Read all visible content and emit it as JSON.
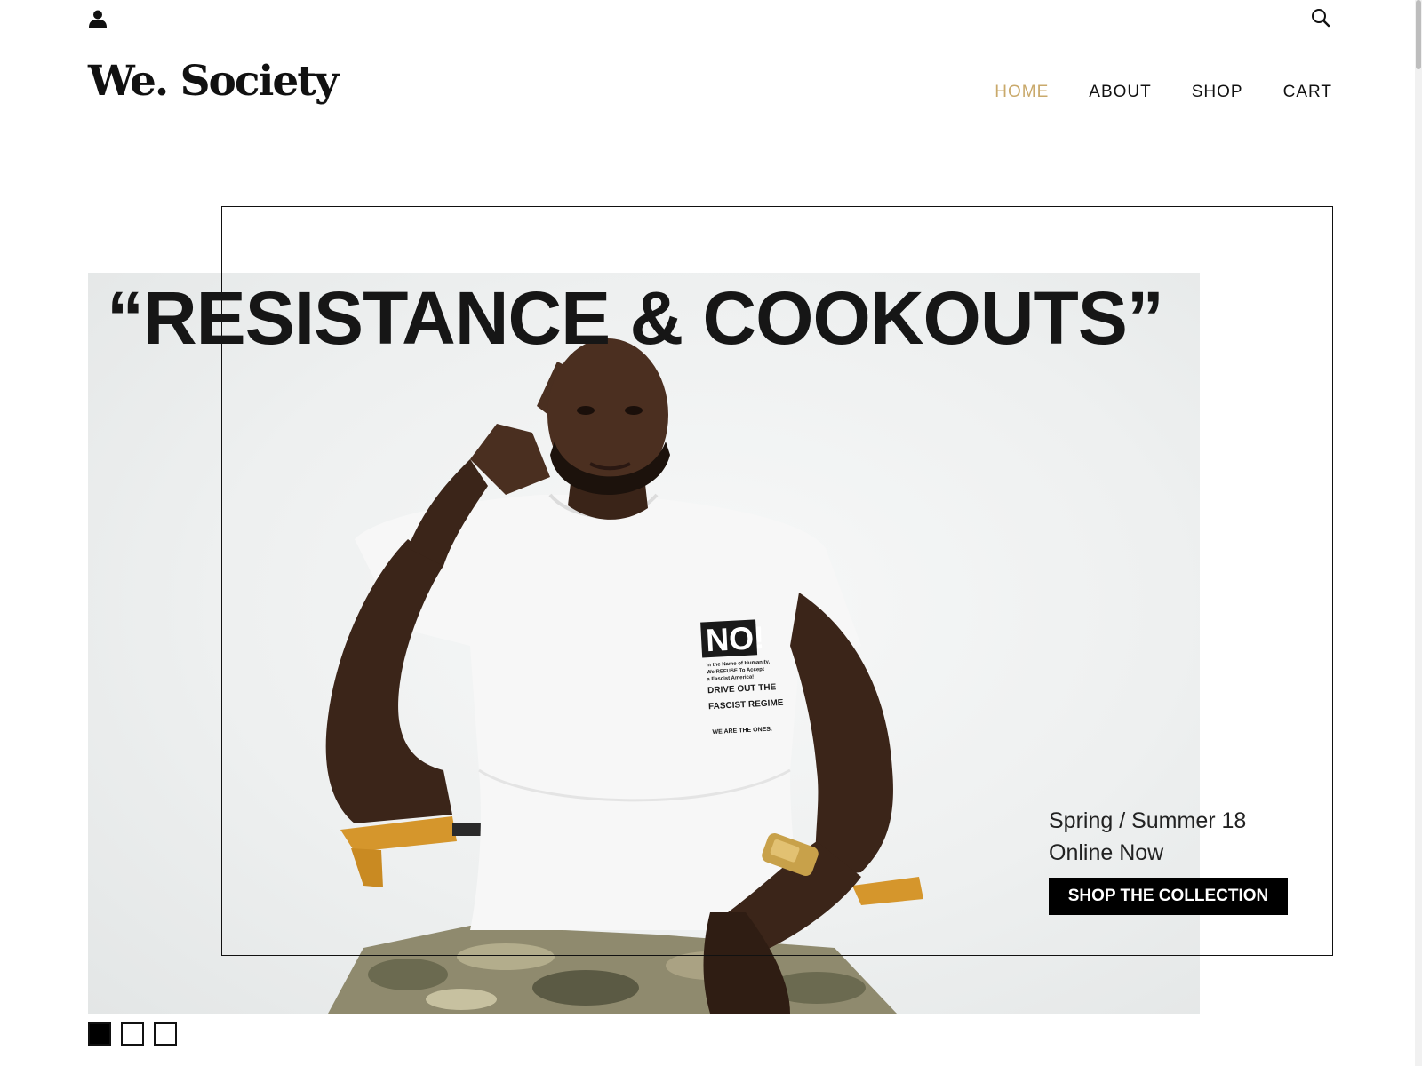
{
  "header": {
    "account_icon": "user-account-icon",
    "search_icon": "magnifier-search-icon",
    "logo_text": "We. Society"
  },
  "nav": {
    "items": [
      {
        "label": "HOME",
        "active": true
      },
      {
        "label": "ABOUT",
        "active": false
      },
      {
        "label": "SHOP",
        "active": false
      },
      {
        "label": "CART",
        "active": false
      }
    ]
  },
  "hero": {
    "headline": "“RESISTANCE & COOKOUTS”",
    "shirt_print": {
      "line1": "NO!",
      "line2": "In the Name of Humanity,",
      "line3": "We REFUSE To Accept",
      "line4": "a Fascist America!",
      "line5": "DRIVE OUT THE",
      "line6": "FASCIST REGIME",
      "line7": "WE ARE THE ONES."
    },
    "promo": {
      "season": "Spring / Summer 18",
      "status": "Online Now",
      "cta_label": "SHOP THE COLLECTION"
    }
  },
  "carousel": {
    "slides_total": 3,
    "active_index": 0
  },
  "colors": {
    "accent_active_nav": "#c9a96b",
    "text": "#111111",
    "button_bg": "#000000",
    "button_text": "#ffffff"
  }
}
